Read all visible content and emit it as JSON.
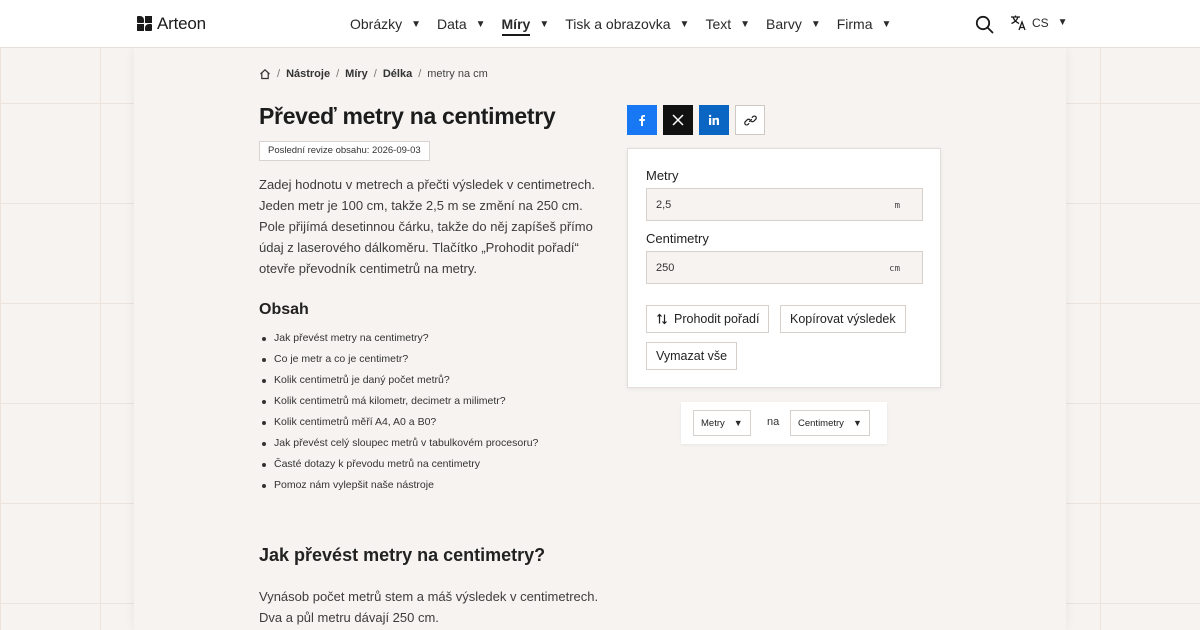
{
  "brand": {
    "name": "Arteon"
  },
  "nav": {
    "items": [
      {
        "label": "Obrázky",
        "active": false
      },
      {
        "label": "Data",
        "active": false
      },
      {
        "label": "Míry",
        "active": true
      },
      {
        "label": "Tisk a obrazovka",
        "active": false
      },
      {
        "label": "Text",
        "active": false
      },
      {
        "label": "Barvy",
        "active": false
      },
      {
        "label": "Firma",
        "active": false
      }
    ],
    "language": "CS"
  },
  "breadcrumb": [
    "Nástroje",
    "Míry",
    "Délka",
    "metry na cm"
  ],
  "page": {
    "title": "Převeď metry na centimetry",
    "revision": "Poslední revize obsahu: 2026-09-03",
    "intro": "Zadej hodnotu v metrech a přečti výsledek v centimetrech. Jeden metr je 100 cm, takže 2,5 m se změní na 250 cm. Pole přijímá desetinnou čárku, takže do něj zapíšeš přímo údaj z laserového dálkoměru. Tlačítko „Prohodit pořadí“ otevře převodník centimetrů na metry."
  },
  "toc": {
    "title": "Obsah",
    "items": [
      "Jak převést metry na centimetry?",
      "Co je metr a co je centimetr?",
      "Kolik centimetrů je daný počet metrů?",
      "Kolik centimetrů má kilometr, decimetr a milimetr?",
      "Kolik centimetrů měří A4, A0 a B0?",
      "Jak převést celý sloupec metrů v tabulkovém procesoru?",
      "Časté dotazy k převodu metrů na centimetry",
      "Pomoz nám vylepšit naše nástroje"
    ]
  },
  "section": {
    "title": "Jak převést metry na centimetry?",
    "text": "Vynásob počet metrů stem a máš výsledek v centimetrech. Dva a půl metru dávají 250 cm."
  },
  "converter": {
    "from_label": "Metry",
    "from_value": "2,5",
    "from_unit": "m",
    "to_label": "Centimetry",
    "to_value": "250",
    "to_unit": "cm",
    "swap_label": "Prohodit pořadí",
    "copy_label": "Kopírovat výsledek",
    "clear_label": "Vymazat vše"
  },
  "unit_select": {
    "from": "Metry",
    "joiner": "na",
    "to": "Centimetry"
  },
  "colors": {
    "facebook": "#1877f2",
    "x": "#111111",
    "linkedin": "#0a66c2"
  }
}
